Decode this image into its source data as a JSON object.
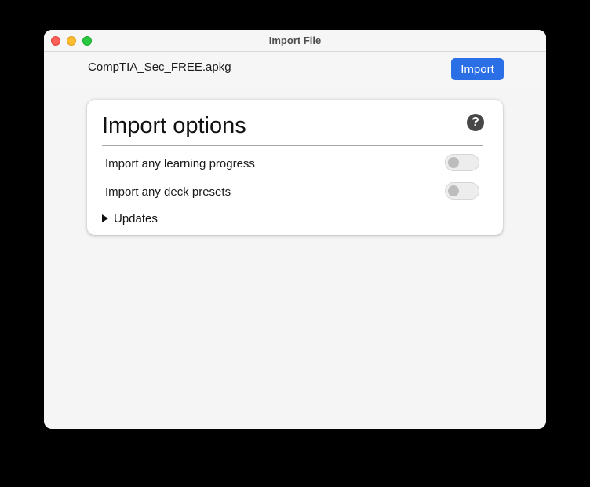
{
  "window": {
    "title": "Import File"
  },
  "toolbar": {
    "filename": "CompTIA_Sec_FREE.apkg",
    "import_label": "Import",
    "accent_color": "#2b6fe6"
  },
  "options": {
    "title": "Import options",
    "help_icon": "question-circle-icon",
    "help_glyph": "?",
    "items": [
      {
        "label": "Import any learning progress",
        "enabled": false
      },
      {
        "label": "Import any deck presets",
        "enabled": false
      }
    ],
    "updates": {
      "label": "Updates",
      "expanded": false
    }
  }
}
